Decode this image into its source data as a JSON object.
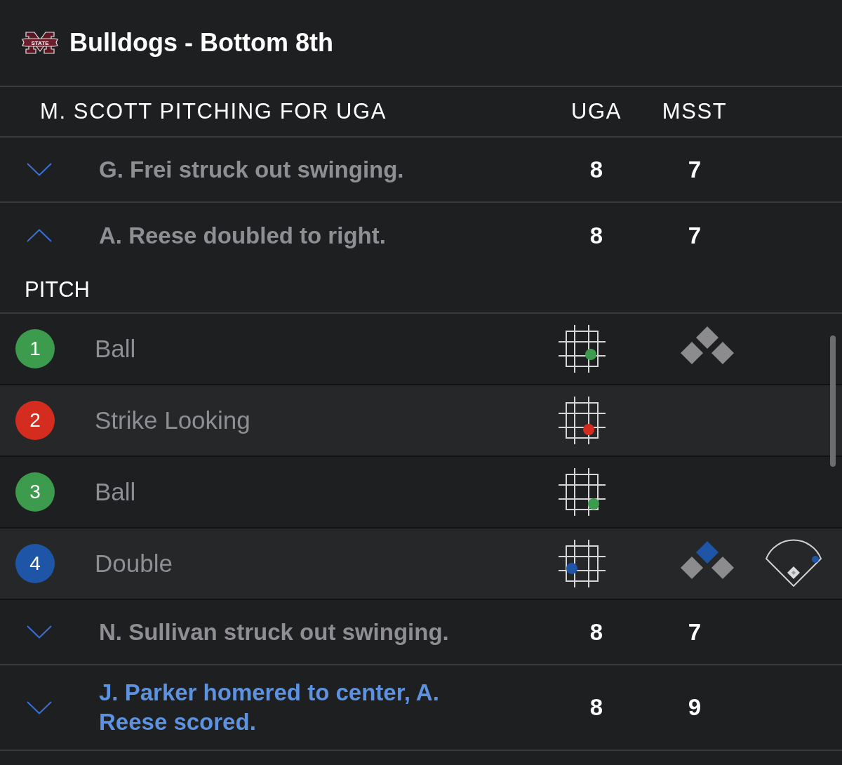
{
  "header": {
    "logo_text": "STATE",
    "title": "Bulldogs - Bottom 8th"
  },
  "columns": {
    "situation": "M. SCOTT PITCHING FOR UGA",
    "away": "UGA",
    "home": "MSST"
  },
  "plays": [
    {
      "text": "G. Frei struck out swinging.",
      "expanded": false,
      "scoring": false,
      "away_score": "8",
      "home_score": "7"
    },
    {
      "text": "A. Reese doubled to right.",
      "expanded": true,
      "scoring": false,
      "away_score": "8",
      "home_score": "7",
      "pitch_heading": "PITCH",
      "pitches": [
        {
          "number": "1",
          "result": "Ball",
          "color": "#3d9b4d",
          "zone_dot": {
            "kind": "lowright"
          },
          "bases": {
            "first": false,
            "second": false,
            "third": false
          }
        },
        {
          "number": "2",
          "result": "Strike Looking",
          "color": "#d42d20",
          "zone_dot": {
            "kind": "lowmid"
          }
        },
        {
          "number": "3",
          "result": "Ball",
          "color": "#3d9b4d",
          "zone_dot": {
            "kind": "lowcorner"
          }
        },
        {
          "number": "4",
          "result": "Double",
          "color": "#1f55a6",
          "zone_dot": {
            "kind": "lowleft"
          },
          "bases": {
            "first": false,
            "second": true,
            "third": false
          },
          "hit_marker": {
            "kind": "rightcorner"
          }
        }
      ]
    },
    {
      "text": "N. Sullivan struck out swinging.",
      "expanded": false,
      "scoring": false,
      "away_score": "8",
      "home_score": "7"
    },
    {
      "text": "J. Parker homered to center, A. Reese scored.",
      "expanded": false,
      "scoring": true,
      "away_score": "8",
      "home_score": "9"
    }
  ]
}
